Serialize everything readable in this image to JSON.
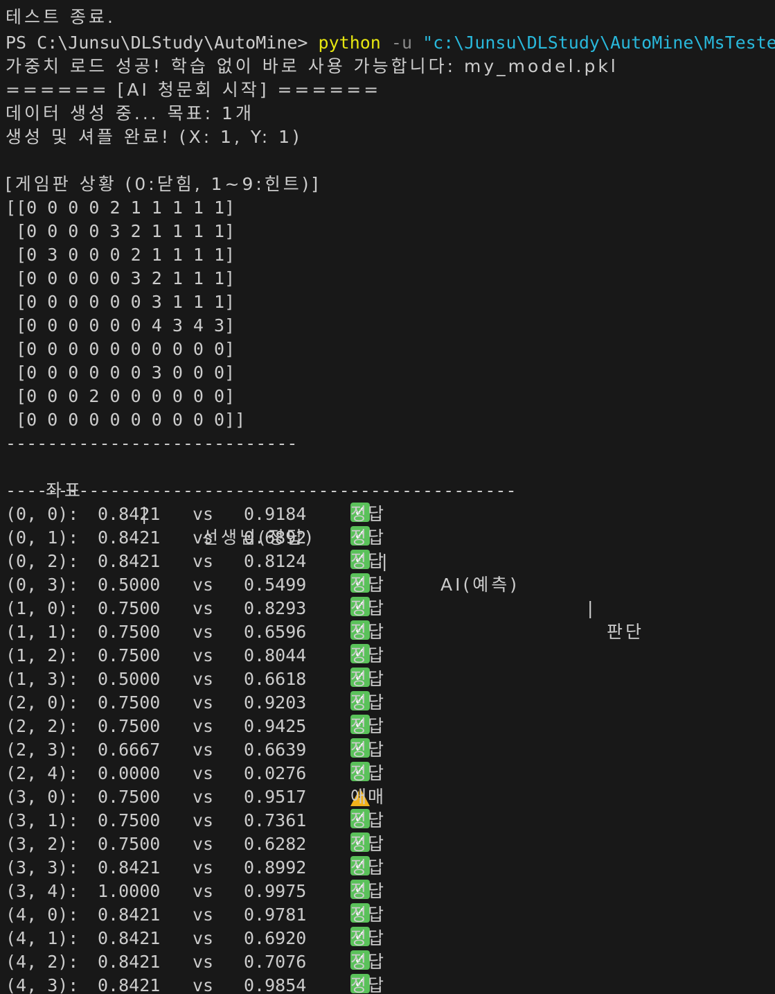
{
  "terminal": {
    "lines": {
      "test_end": "테스트 종료.",
      "prompt": "PS C:\\Junsu\\DLStudy\\AutoMine> ",
      "cmd": "python",
      "flag": " -u ",
      "path": "\"c:\\Junsu\\DLStudy\\AutoMine\\MsTeste",
      "weights_loaded": "가중치 로드 성공! 학습 없이 바로 사용 가능합니다: my_model.pkl",
      "ai_header": "====== [AI 청문회 시작] ======",
      "generating": "데이터 생성 중... 목표: 1개",
      "shuffle_done": "생성 및 셔플 완료! (X: 1, Y: 1)",
      "board_title": "[게임판 상황 (0:닫힘, 1~9:힌트)]",
      "board": [
        "[[0 0 0 0 2 1 1 1 1 1]",
        " [0 0 0 0 3 2 1 1 1 1]",
        " [0 3 0 0 0 2 1 1 1 1]",
        " [0 0 0 0 0 3 2 1 1 1]",
        " [0 0 0 0 0 0 3 1 1 1]",
        " [0 0 0 0 0 0 4 3 4 3]",
        " [0 0 0 0 0 0 0 0 0 0]",
        " [0 0 0 0 0 0 3 0 0 0]",
        " [0 0 0 2 0 0 0 0 0 0]",
        " [0 0 0 0 0 0 0 0 0 0]]"
      ],
      "divider_short": "----------------------------",
      "col_coord": "좌표",
      "col_teacher": "선생님(정답)",
      "col_ai": "AI(예측)",
      "col_verdict": "판단",
      "sep": "|",
      "divider_long": "-------------------------------------------------"
    },
    "vs_label": "vs",
    "results": [
      {
        "coord": "(0, 0):",
        "teacher": "0.8421",
        "ai": "0.9184",
        "verdict": "정답",
        "status": "correct"
      },
      {
        "coord": "(0, 1):",
        "teacher": "0.8421",
        "ai": "0.6892",
        "verdict": "정답",
        "status": "correct"
      },
      {
        "coord": "(0, 2):",
        "teacher": "0.8421",
        "ai": "0.8124",
        "verdict": "정답",
        "status": "correct"
      },
      {
        "coord": "(0, 3):",
        "teacher": "0.5000",
        "ai": "0.5499",
        "verdict": "정답",
        "status": "correct"
      },
      {
        "coord": "(1, 0):",
        "teacher": "0.7500",
        "ai": "0.8293",
        "verdict": "정답",
        "status": "correct"
      },
      {
        "coord": "(1, 1):",
        "teacher": "0.7500",
        "ai": "0.6596",
        "verdict": "정답",
        "status": "correct"
      },
      {
        "coord": "(1, 2):",
        "teacher": "0.7500",
        "ai": "0.8044",
        "verdict": "정답",
        "status": "correct"
      },
      {
        "coord": "(1, 3):",
        "teacher": "0.5000",
        "ai": "0.6618",
        "verdict": "정답",
        "status": "correct"
      },
      {
        "coord": "(2, 0):",
        "teacher": "0.7500",
        "ai": "0.9203",
        "verdict": "정답",
        "status": "correct"
      },
      {
        "coord": "(2, 2):",
        "teacher": "0.7500",
        "ai": "0.9425",
        "verdict": "정답",
        "status": "correct"
      },
      {
        "coord": "(2, 3):",
        "teacher": "0.6667",
        "ai": "0.6639",
        "verdict": "정답",
        "status": "correct"
      },
      {
        "coord": "(2, 4):",
        "teacher": "0.0000",
        "ai": "0.0276",
        "verdict": "정답",
        "status": "correct"
      },
      {
        "coord": "(3, 0):",
        "teacher": "0.7500",
        "ai": "0.9517",
        "verdict": "애매",
        "status": "ambiguous"
      },
      {
        "coord": "(3, 1):",
        "teacher": "0.7500",
        "ai": "0.7361",
        "verdict": "정답",
        "status": "correct"
      },
      {
        "coord": "(3, 2):",
        "teacher": "0.7500",
        "ai": "0.6282",
        "verdict": "정답",
        "status": "correct"
      },
      {
        "coord": "(3, 3):",
        "teacher": "0.8421",
        "ai": "0.8992",
        "verdict": "정답",
        "status": "correct"
      },
      {
        "coord": "(3, 4):",
        "teacher": "1.0000",
        "ai": "0.9975",
        "verdict": "정답",
        "status": "correct"
      },
      {
        "coord": "(4, 0):",
        "teacher": "0.8421",
        "ai": "0.9781",
        "verdict": "정답",
        "status": "correct"
      },
      {
        "coord": "(4, 1):",
        "teacher": "0.8421",
        "ai": "0.6920",
        "verdict": "정답",
        "status": "correct"
      },
      {
        "coord": "(4, 2):",
        "teacher": "0.8421",
        "ai": "0.7076",
        "verdict": "정답",
        "status": "correct"
      },
      {
        "coord": "(4, 3):",
        "teacher": "0.8421",
        "ai": "0.9854",
        "verdict": "정답",
        "status": "correct"
      }
    ],
    "icons": {
      "correct": "check-mark-icon",
      "ambiguous": "warning-icon"
    },
    "colors": {
      "background": "#181818",
      "text": "#cccccc",
      "command": "#e5e510",
      "string": "#29b8db",
      "flag": "#8a8a8a",
      "check": "#5ac15a",
      "warning": "#f2b21b"
    }
  }
}
